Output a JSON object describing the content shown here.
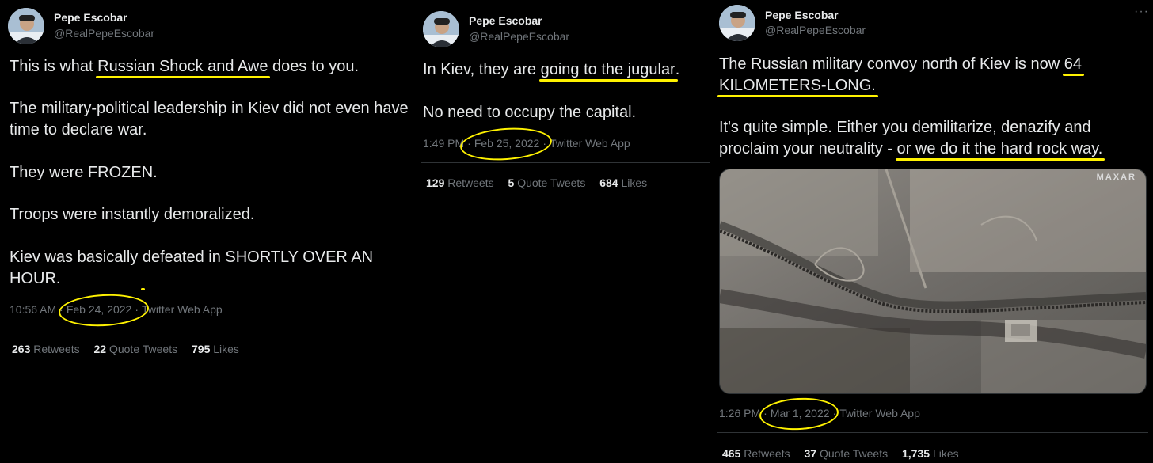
{
  "tweets": [
    {
      "name": "Pepe Escobar",
      "handle": "@RealPepeEscobar",
      "paragraphs": [
        [
          "This is what ",
          {
            "hl": "Russian Shock and Awe"
          },
          " does to you."
        ],
        [
          "The military-political leadership in Kiev did not even have time to declare war."
        ],
        [
          "They were FROZEN."
        ],
        [
          "Troops were instantly demoralized."
        ],
        [
          "Kiev was basically ",
          {
            "hl": "defeated in SHORTLY OVER AN HOUR"
          },
          "."
        ]
      ],
      "time": "10:56 AM",
      "date": "Feb 24, 2022",
      "source": "Twitter Web App",
      "stats": [
        {
          "num": "263",
          "label": "Retweets"
        },
        {
          "num": "22",
          "label": "Quote Tweets"
        },
        {
          "num": "795",
          "label": "Likes"
        }
      ]
    },
    {
      "name": "Pepe Escobar",
      "handle": "@RealPepeEscobar",
      "paragraphs": [
        [
          "In Kiev, they are ",
          {
            "hl": "going to the jugular"
          },
          "."
        ],
        [
          "No need to occupy the capital."
        ]
      ],
      "time": "1:49 PM",
      "date": "Feb 25, 2022",
      "source": "Twitter Web App",
      "stats": [
        {
          "num": "129",
          "label": "Retweets"
        },
        {
          "num": "5",
          "label": "Quote Tweets"
        },
        {
          "num": "684",
          "label": "Likes"
        }
      ]
    },
    {
      "name": "Pepe Escobar",
      "handle": "@RealPepeEscobar",
      "more": "···",
      "paragraphs": [
        [
          "The Russian military convoy north of Kiev is now ",
          {
            "hl": "64"
          },
          " ",
          {
            "hl": "KILOMETERS-LONG."
          }
        ],
        [
          "It's quite simple. Either you demilitarize, denazify and proclaim your neutrality - ",
          {
            "hl": "or we do it the hard rock way."
          }
        ]
      ],
      "image_watermark": "MAXAR",
      "time": "1:26 PM",
      "date": "Mar 1, 2022",
      "source": "Twitter Web App",
      "stats": [
        {
          "num": "465",
          "label": "Retweets"
        },
        {
          "num": "37",
          "label": "Quote Tweets"
        },
        {
          "num": "1,735",
          "label": "Likes"
        }
      ]
    }
  ],
  "colors": {
    "background": "#000000",
    "text": "#e7e9ea",
    "muted": "#71767b",
    "annotation": "#fff200",
    "divider": "#2f3336"
  }
}
